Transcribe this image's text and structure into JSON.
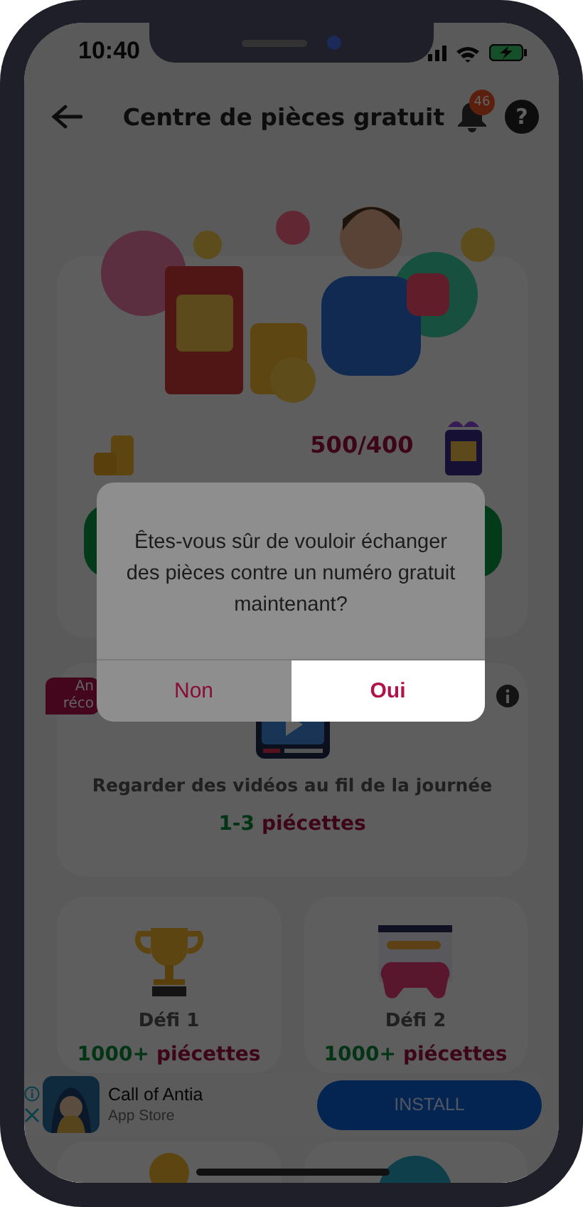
{
  "status_bar": {
    "time": "10:40"
  },
  "header": {
    "title": "Centre de pièces gratuit",
    "notification_count": "46",
    "help": "?"
  },
  "hero": {
    "progress": "500/400"
  },
  "video_task": {
    "badge_lines": [
      "An",
      "réco"
    ],
    "title": "Regarder des vidéos au fil de la journée",
    "reward_amount": "1-3",
    "reward_unit": "piécettes"
  },
  "challenges": [
    {
      "kind": "trophy",
      "title": "Défi 1",
      "reward_amount": "1000+",
      "reward_unit": "piécettes"
    },
    {
      "kind": "gamepad",
      "title": "Défi 2",
      "reward_amount": "1000+",
      "reward_unit": "piécettes"
    }
  ],
  "ad": {
    "app_name": "Call of Antia",
    "store": "App Store",
    "button": "INSTALL"
  },
  "dialog": {
    "message": "Êtes-vous sûr de vouloir échanger des pièces contre un numéro gratuit maintenant?",
    "buttons": [
      {
        "label": "Non",
        "selected": false
      },
      {
        "label": "Oui",
        "selected": true
      }
    ]
  }
}
